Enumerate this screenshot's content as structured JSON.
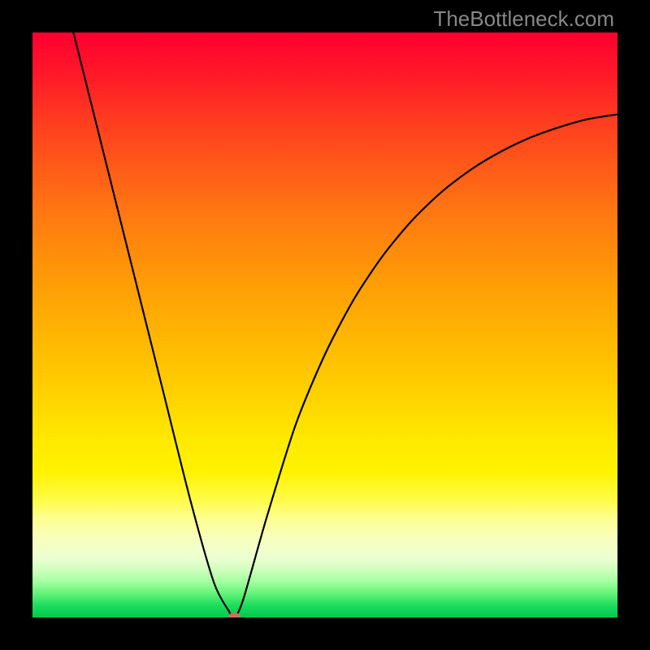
{
  "watermark": "TheBottleneck.com",
  "chart_data": {
    "type": "line",
    "title": "",
    "xlabel": "",
    "ylabel": "",
    "xlim": [
      0,
      1
    ],
    "ylim": [
      0,
      1
    ],
    "legend": false,
    "grid": false,
    "background_gradient": {
      "top": "#ff0030",
      "bottom": "#00c94f"
    },
    "series": [
      {
        "name": "curve",
        "color": "#000000",
        "x": [
          0.07,
          0.12,
          0.17,
          0.22,
          0.27,
          0.31,
          0.335,
          0.345,
          0.36,
          0.4,
          0.45,
          0.5,
          0.55,
          0.6,
          0.65,
          0.7,
          0.75,
          0.8,
          0.85,
          0.9,
          0.95,
          1.0
        ],
        "values": [
          1.0,
          0.8,
          0.6,
          0.4,
          0.2,
          0.06,
          0.012,
          0.0,
          0.03,
          0.17,
          0.33,
          0.45,
          0.545,
          0.62,
          0.68,
          0.728,
          0.766,
          0.796,
          0.82,
          0.838,
          0.852,
          0.86
        ]
      }
    ],
    "marker": {
      "x": 0.345,
      "y": 0.0,
      "color": "#cc6f5f"
    }
  }
}
